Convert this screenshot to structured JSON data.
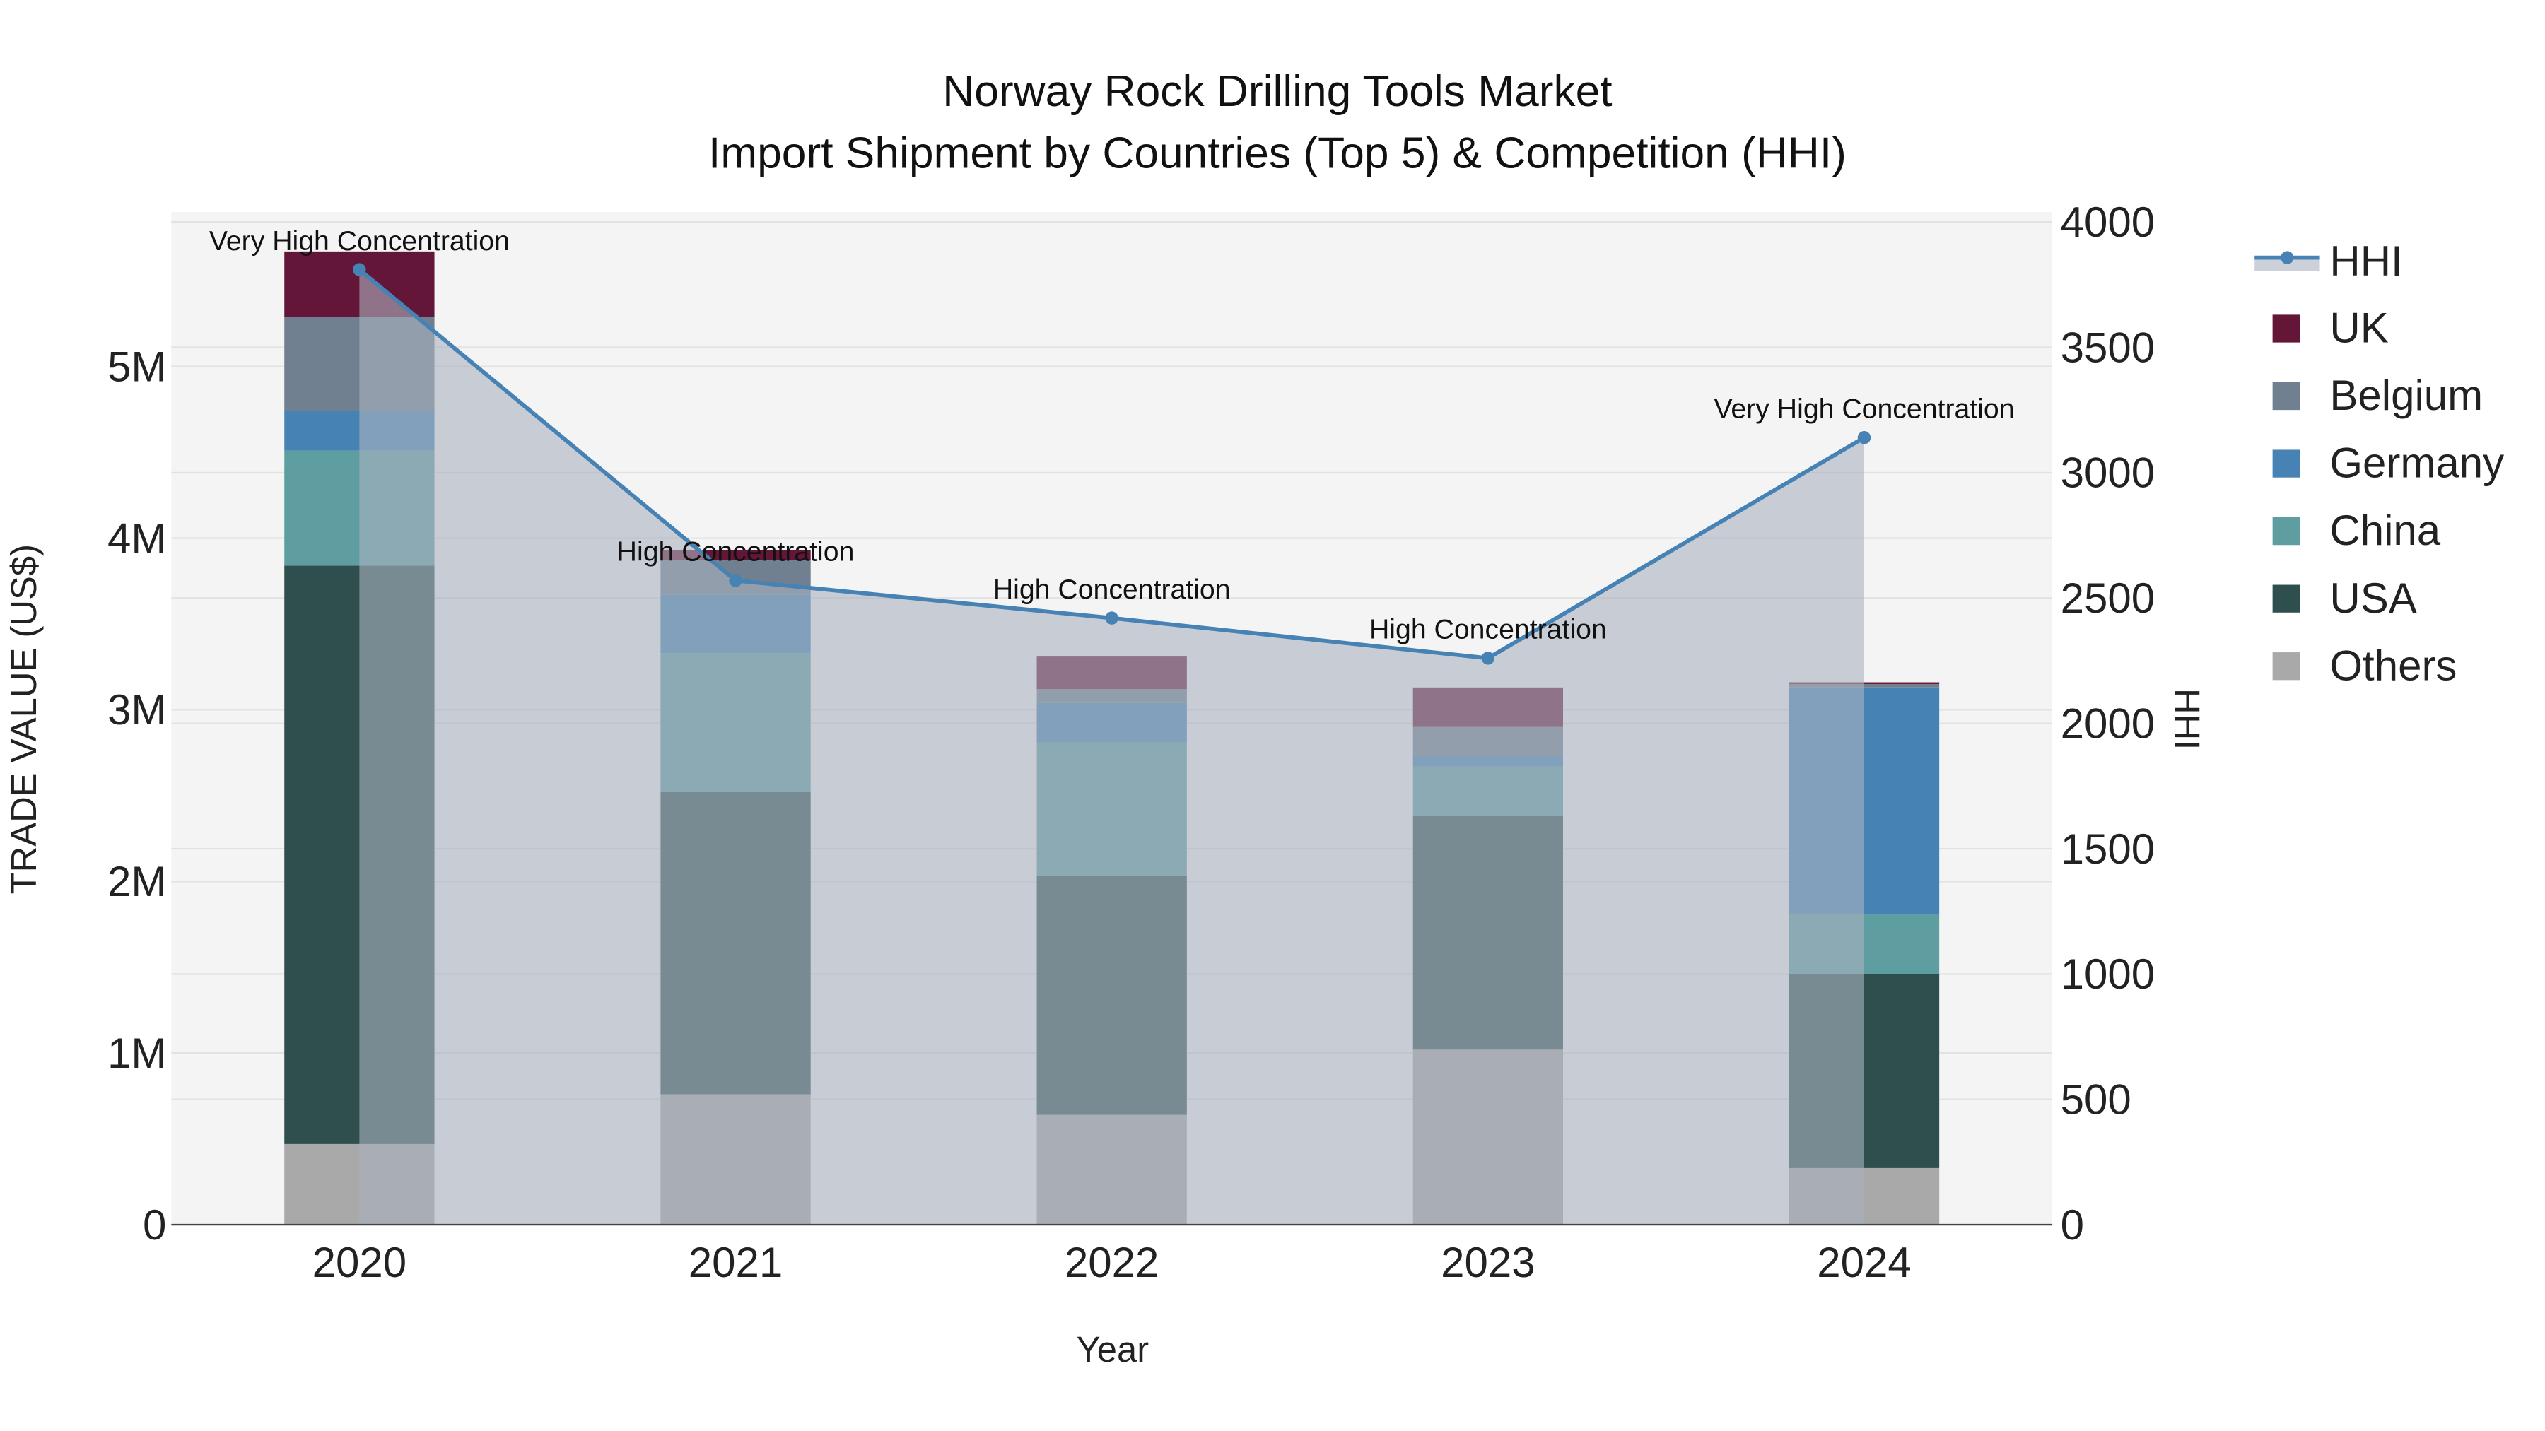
{
  "chart_data": {
    "type": "bar",
    "stacked": true,
    "title": "Norway Rock Drilling Tools Market",
    "subtitle": "Import Shipment by Countries (Top 5) & Competition (HHI)",
    "xlabel": "Year",
    "ylabel": "TRADE VALUE (US$)",
    "y2label": "HHI",
    "categories": [
      "2020",
      "2021",
      "2022",
      "2023",
      "2024"
    ],
    "ylim": [
      0,
      5900000
    ],
    "y2lim": [
      0,
      4040
    ],
    "yticks": [
      {
        "v": 0,
        "label": "0"
      },
      {
        "v": 1000000,
        "label": "1M"
      },
      {
        "v": 2000000,
        "label": "2M"
      },
      {
        "v": 3000000,
        "label": "3M"
      },
      {
        "v": 4000000,
        "label": "4M"
      },
      {
        "v": 5000000,
        "label": "5M"
      }
    ],
    "y2ticks": [
      {
        "v": 0,
        "label": "0"
      },
      {
        "v": 500,
        "label": "500"
      },
      {
        "v": 1000,
        "label": "1000"
      },
      {
        "v": 1500,
        "label": "1500"
      },
      {
        "v": 2000,
        "label": "2000"
      },
      {
        "v": 2500,
        "label": "2500"
      },
      {
        "v": 3000,
        "label": "3000"
      },
      {
        "v": 3500,
        "label": "3500"
      },
      {
        "v": 4000,
        "label": "4000"
      }
    ],
    "series": [
      {
        "name": "Others",
        "color": "#A9A9A9",
        "values": [
          470000,
          760000,
          640000,
          1020000,
          330000
        ]
      },
      {
        "name": "USA",
        "color": "#2F4F4F",
        "values": [
          3370000,
          1760000,
          1390000,
          1360000,
          1130000
        ]
      },
      {
        "name": "China",
        "color": "#5F9EA0",
        "values": [
          670000,
          810000,
          780000,
          290000,
          350000
        ]
      },
      {
        "name": "Germany",
        "color": "#4682B4",
        "values": [
          230000,
          340000,
          230000,
          60000,
          1320000
        ]
      },
      {
        "name": "Belgium",
        "color": "#708090",
        "values": [
          550000,
          200000,
          80000,
          170000,
          20000
        ]
      },
      {
        "name": "UK",
        "color": "#641638",
        "values": [
          380000,
          60000,
          190000,
          230000,
          10000
        ]
      }
    ],
    "hhi": {
      "name": "HHI",
      "color": "#4682B4",
      "values": [
        3810,
        2570,
        2420,
        2260,
        3140
      ],
      "annotations": [
        "Very High Concentration",
        "High Concentration",
        "High Concentration",
        "High Concentration",
        "Very High Concentration"
      ]
    },
    "legend": {
      "placement": "right",
      "order": [
        "HHI",
        "UK",
        "Belgium",
        "Germany",
        "China",
        "USA",
        "Others"
      ]
    },
    "grid": true
  }
}
